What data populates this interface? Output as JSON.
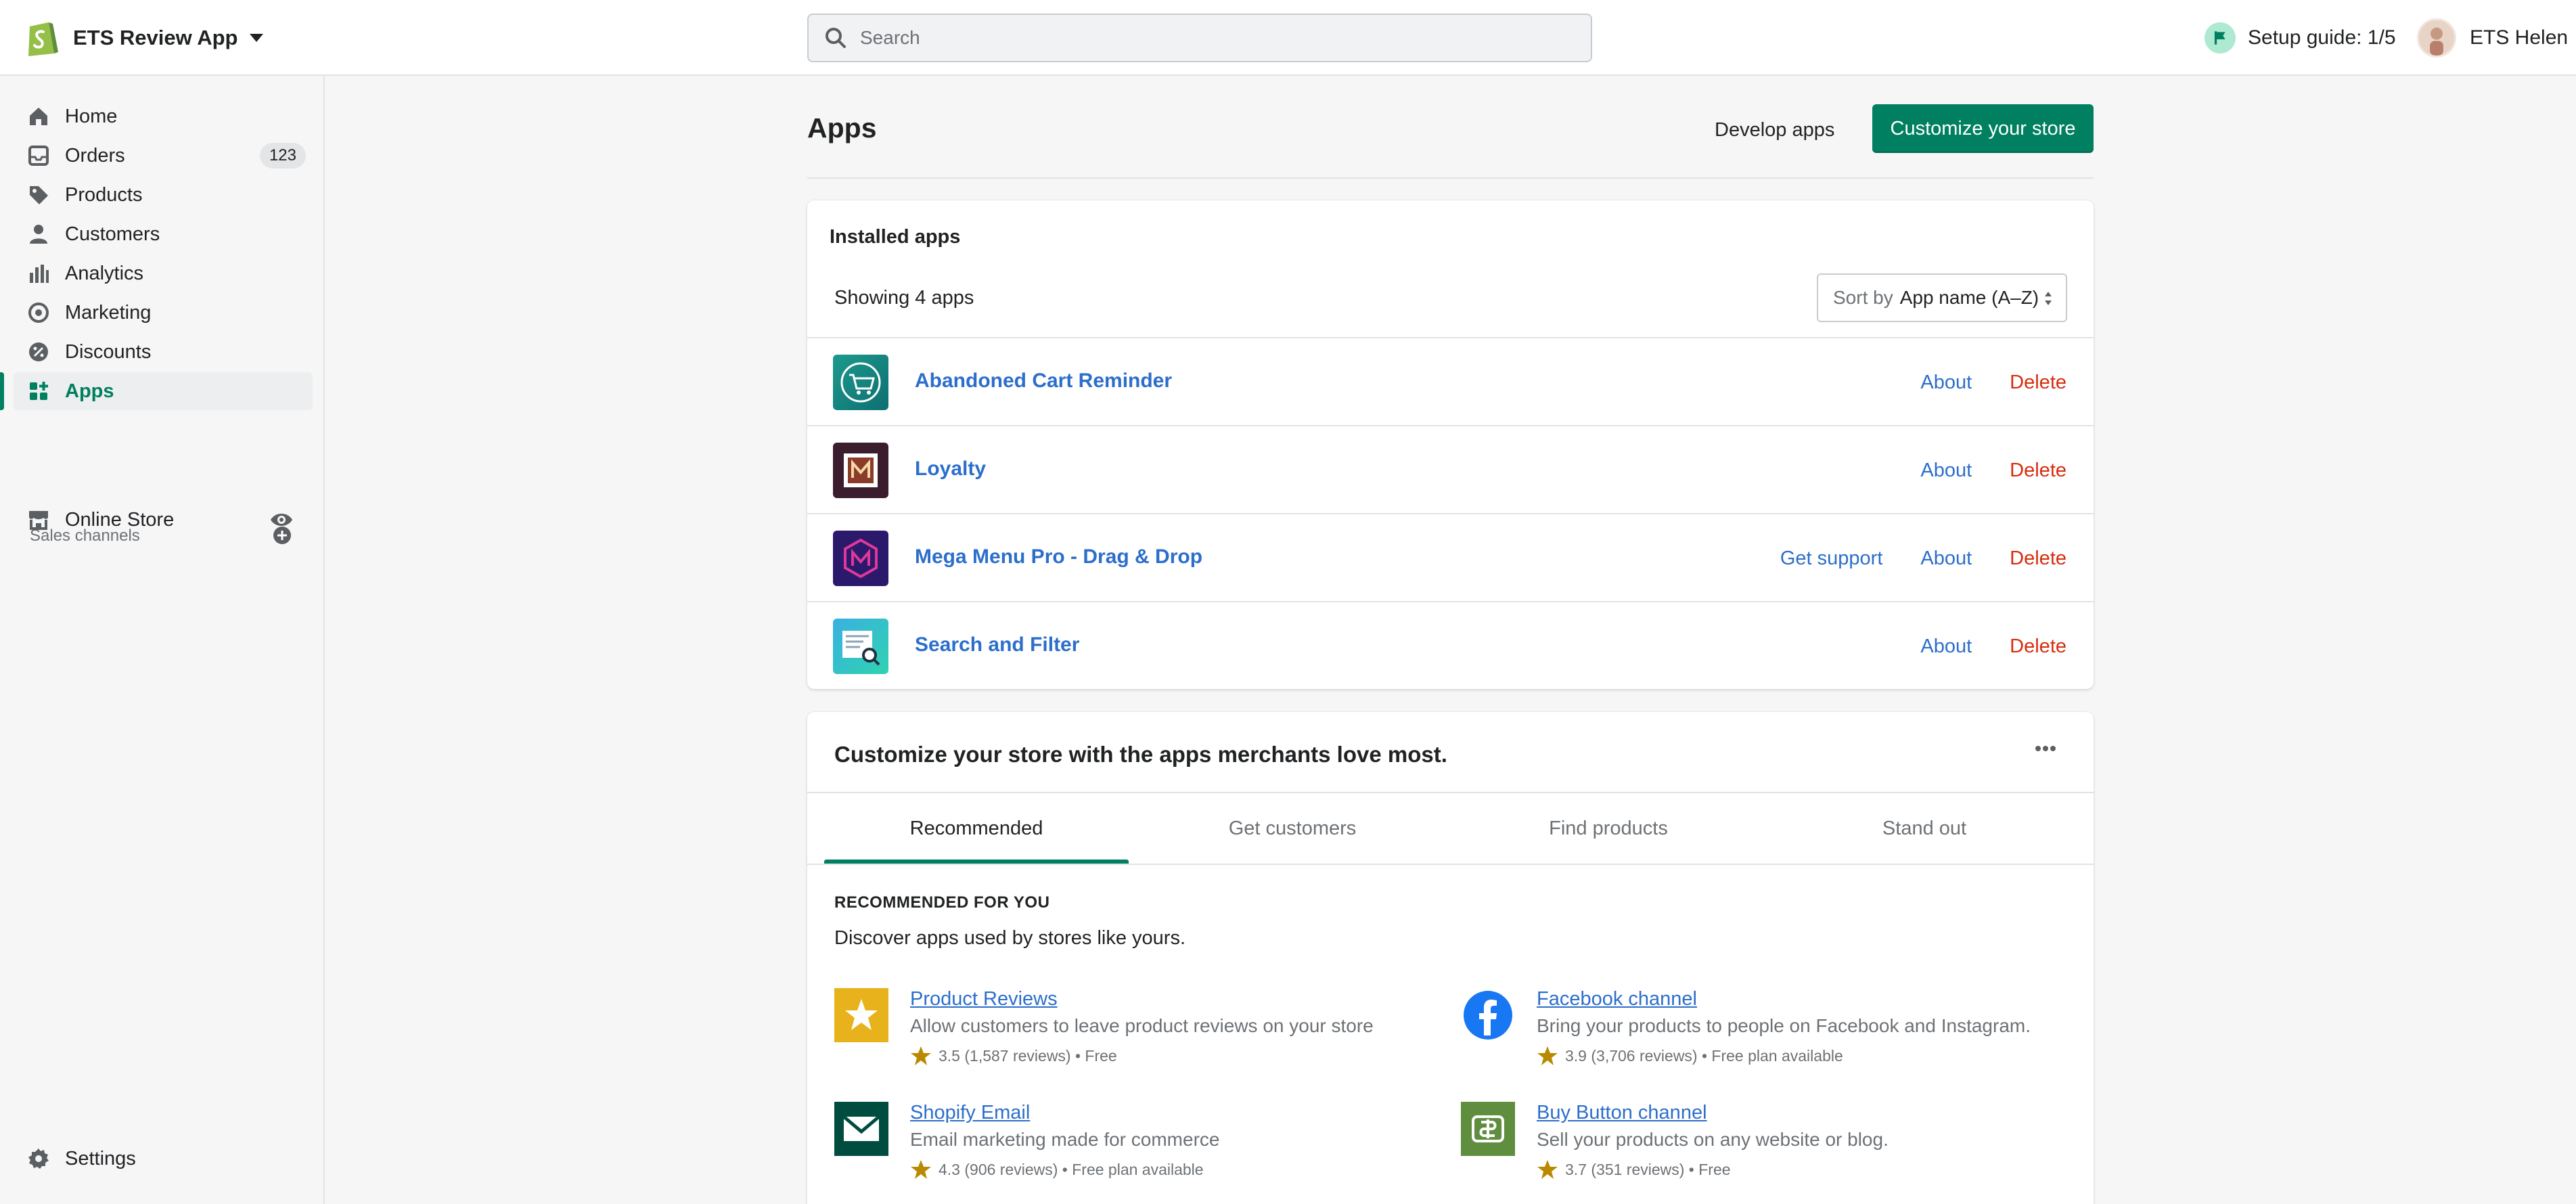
{
  "topbar": {
    "store_name": "ETS Review App",
    "search_placeholder": "Search",
    "setup_guide": "Setup guide: 1/5",
    "user_name": "ETS Helen"
  },
  "sidebar": {
    "items": [
      {
        "label": "Home",
        "icon": "home-icon"
      },
      {
        "label": "Orders",
        "icon": "orders-icon",
        "badge": "123"
      },
      {
        "label": "Products",
        "icon": "tag-icon"
      },
      {
        "label": "Customers",
        "icon": "person-icon"
      },
      {
        "label": "Analytics",
        "icon": "bar-chart-icon"
      },
      {
        "label": "Marketing",
        "icon": "target-icon"
      },
      {
        "label": "Discounts",
        "icon": "discount-icon"
      },
      {
        "label": "Apps",
        "icon": "apps-grid-icon",
        "active": true
      }
    ],
    "sales_channels_label": "Sales channels",
    "online_store_label": "Online Store",
    "settings_label": "Settings"
  },
  "main": {
    "title": "Apps",
    "develop_apps": "Develop apps",
    "customize_store": "Customize your store"
  },
  "installed": {
    "heading": "Installed apps",
    "showing": "Showing 4 apps",
    "sort_prefix": "Sort by",
    "sort_value": "App name (A–Z)",
    "apps": [
      {
        "name": "Abandoned Cart Reminder",
        "about": "About",
        "delete": "Delete"
      },
      {
        "name": "Loyalty",
        "about": "About",
        "delete": "Delete"
      },
      {
        "name": "Mega Menu Pro - Drag & Drop",
        "support": "Get support",
        "about": "About",
        "delete": "Delete"
      },
      {
        "name": "Search and Filter",
        "about": "About",
        "delete": "Delete"
      }
    ]
  },
  "recommend": {
    "title": "Customize your store with the apps merchants love most.",
    "tabs": [
      "Recommended",
      "Get customers",
      "Find products",
      "Stand out"
    ],
    "kicker": "RECOMMENDED FOR YOU",
    "subtitle": "Discover apps used by stores like yours.",
    "apps": [
      {
        "name": "Product Reviews",
        "desc": "Allow customers to leave product reviews on your store",
        "meta": "3.5 (1,587 reviews) • Free"
      },
      {
        "name": "Facebook channel",
        "desc": "Bring your products to people on Facebook and Instagram.",
        "meta": "3.9 (3,706 reviews) • Free plan available"
      },
      {
        "name": "Shopify Email",
        "desc": "Email marketing made for commerce",
        "meta": "4.3 (906 reviews) • Free plan available"
      },
      {
        "name": "Buy Button channel",
        "desc": "Sell your products on any website or blog.",
        "meta": "3.7 (351 reviews) • Free"
      }
    ]
  },
  "colors": {
    "primary": "#008060",
    "link": "#2c6ecb",
    "critical": "#d72c0d",
    "star": "#b98900"
  }
}
